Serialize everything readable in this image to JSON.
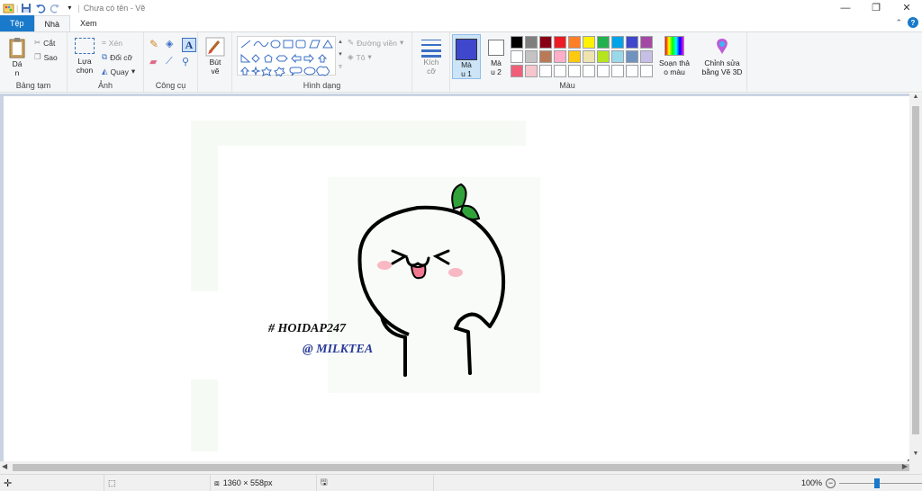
{
  "window": {
    "title": "Chưa có tên - Vẽ"
  },
  "tabs": {
    "file": "Tệp",
    "home": "Nhà",
    "view": "Xem"
  },
  "help": "?",
  "ribbon": {
    "clipboard": {
      "paste": "Dá\nn",
      "cut": "Cắt",
      "copy": "Sao",
      "label": "Bảng tạm"
    },
    "image": {
      "select": "Lựa\nchọn",
      "crop": "Xén",
      "resize": "Đổi cỡ",
      "rotate": "Quay",
      "label": "Ảnh"
    },
    "tools": {
      "label": "Công cụ"
    },
    "brushes": {
      "label": "Bút\nvẽ"
    },
    "shapes": {
      "outline": "Đường viền",
      "fill": "Tô",
      "label": "Hình dạng"
    },
    "size": {
      "label": "Kích\ncỡ"
    },
    "color1": {
      "label": "Mà\nu 1",
      "value": "#3f48cc"
    },
    "color2": {
      "label": "Mà\nu 2",
      "value": "#ffffff"
    },
    "edit_colors": {
      "label": "Soạn thả\no màu"
    },
    "paint3d": {
      "label": "Chỉnh sửa\nbằng Vẽ 3D"
    },
    "colors_label": "Màu"
  },
  "palette_row1": [
    "#000000",
    "#7f7f7f",
    "#880015",
    "#ed1c24",
    "#ff7f27",
    "#fff200",
    "#22b14c",
    "#00a2e8",
    "#3f48cc",
    "#a349a4"
  ],
  "palette_row2": [
    "#ffffff",
    "#c3c3c3",
    "#b97a57",
    "#ffaec9",
    "#ffc90e",
    "#efe4b0",
    "#b5e61d",
    "#99d9ea",
    "#7092be",
    "#c8bfe7"
  ],
  "palette_row3": [
    "#f05f78",
    "#f5c6cb",
    "#ffffff",
    "#ffffff",
    "#ffffff",
    "#ffffff",
    "#ffffff",
    "#ffffff",
    "#ffffff",
    "#ffffff"
  ],
  "canvas": {
    "text1": "# HOIDAP247",
    "text2": "@ MILKTEA",
    "face": "> ω <"
  },
  "status": {
    "dimensions": "1360 × 558px",
    "zoom": "100%"
  }
}
